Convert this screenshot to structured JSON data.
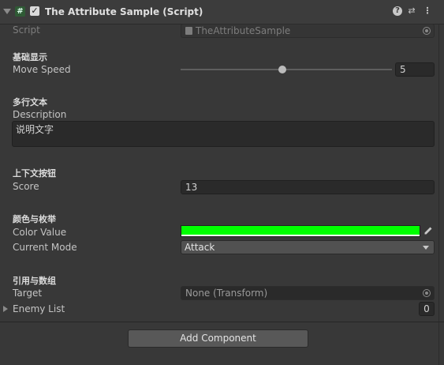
{
  "component": {
    "title": "The Attribute Sample (Script)",
    "script_label": "Script",
    "script_value": "TheAttributeSample"
  },
  "sections": {
    "basic": "基础显示",
    "multiline": "多行文本",
    "context": "上下文按钮",
    "color_enum": "颜色与枚举",
    "reference": "引用与数组"
  },
  "fields": {
    "move_speed": {
      "label": "Move Speed",
      "value": "5",
      "slider_fraction": 0.48
    },
    "description": {
      "label": "Description",
      "value": "说明文字"
    },
    "score": {
      "label": "Score",
      "value": "13"
    },
    "color_value": {
      "label": "Color Value",
      "color": "#00ff00"
    },
    "current_mode": {
      "label": "Current Mode",
      "value": "Attack"
    },
    "target": {
      "label": "Target",
      "value": "None (Transform)"
    },
    "enemy_list": {
      "label": "Enemy List",
      "count": "0"
    }
  },
  "buttons": {
    "add_component": "Add Component"
  },
  "icons": {
    "fold": "chevron-down-icon",
    "script": "#",
    "enabled": "✓",
    "help": "?",
    "presets": "⇄",
    "menu": "⋮",
    "eyedropper": "eyedropper-icon"
  }
}
